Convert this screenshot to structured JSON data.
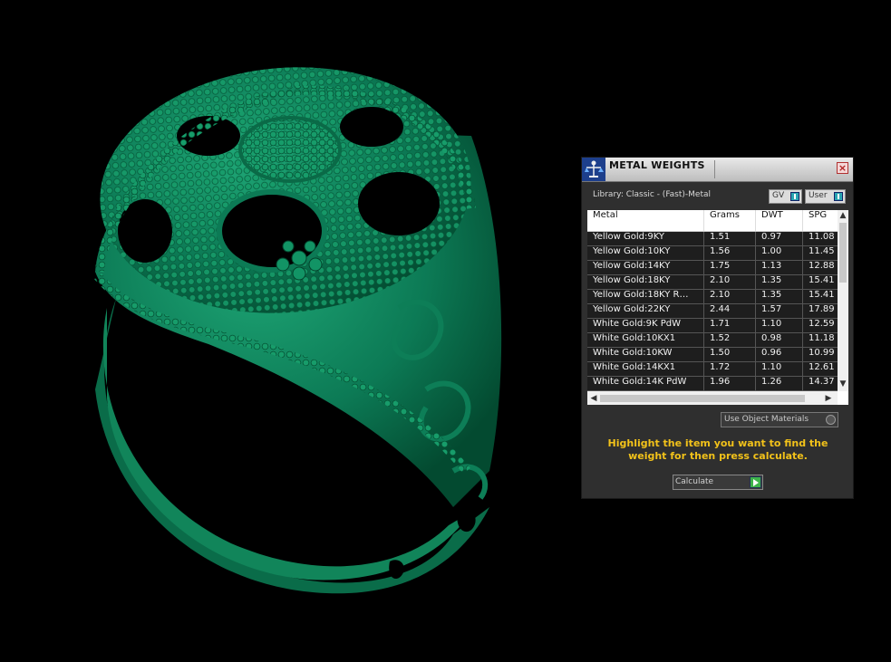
{
  "panel": {
    "title": "METAL WEIGHTS",
    "library_label": "Library: Classic - (Fast)-Metal",
    "gv_label": "GV",
    "user_label": "User",
    "use_object_materials": "Use Object Materials",
    "instructions": "Highlight the item you want to find the weight for then press calculate.",
    "calculate_label": "Calculate"
  },
  "table": {
    "columns": [
      "Metal",
      "Grams",
      "DWT",
      "SPG"
    ],
    "rows": [
      [
        "Yellow Gold:9KY",
        "1.51",
        "0.97",
        "11.08"
      ],
      [
        "Yellow Gold:10KY",
        "1.56",
        "1.00",
        "11.45"
      ],
      [
        "Yellow Gold:14KY",
        "1.75",
        "1.13",
        "12.88"
      ],
      [
        "Yellow Gold:18KY",
        "2.10",
        "1.35",
        "15.41"
      ],
      [
        "Yellow Gold:18KY R…",
        "2.10",
        "1.35",
        "15.41"
      ],
      [
        "Yellow Gold:22KY",
        "2.44",
        "1.57",
        "17.89"
      ],
      [
        "White Gold:9K PdW",
        "1.71",
        "1.10",
        "12.59"
      ],
      [
        "White Gold:10KX1",
        "1.52",
        "0.98",
        "11.18"
      ],
      [
        "White Gold:10KW",
        "1.50",
        "0.96",
        "10.99"
      ],
      [
        "White Gold:14KX1",
        "1.72",
        "1.10",
        "12.61"
      ],
      [
        "White Gold:14K PdW",
        "1.96",
        "1.26",
        "14.37"
      ]
    ]
  },
  "colors": {
    "ring": "#0e7a55",
    "background": "#000000",
    "panel_bg": "#2f2f2f",
    "instruction_text": "#f2c21a",
    "go_button": "#3db34a"
  },
  "icons": {
    "app": "scale-icon",
    "close": "close-icon",
    "calculate": "play-icon"
  }
}
